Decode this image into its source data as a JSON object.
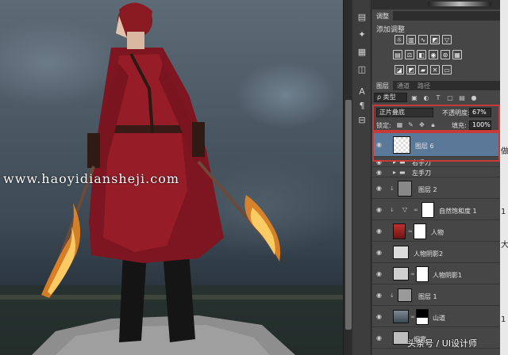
{
  "canvas": {
    "watermark": "www.haoyidiansheji.com"
  },
  "tool_column": {
    "icons": [
      "history-icon",
      "adjust-icon",
      "swatches-icon",
      "layer-comp-icon",
      "clone-icon",
      "character-icon",
      "paragraph-icon",
      "properties-icon"
    ]
  },
  "adjustments_panel": {
    "tabs": [
      "调整"
    ],
    "title": "添加调整",
    "row1": [
      "brightness-icon",
      "levels-icon",
      "curves-icon",
      "exposure-icon",
      "vibrance-icon"
    ],
    "row2": [
      "hue-saturation-icon",
      "color-balance-icon",
      "black-white-icon",
      "photo-filter-icon",
      "channel-mixer-icon",
      "color-lookup-icon"
    ],
    "row3": [
      "invert-icon",
      "posterize-icon",
      "threshold-icon",
      "selective-color-icon",
      "gradient-map-icon"
    ]
  },
  "layers_panel": {
    "tabs": [
      "图层",
      "通道",
      "路径"
    ],
    "filter": "ρ 类型",
    "blend_mode": "正片叠底",
    "opacity_label": "不透明度:",
    "opacity_value": "67%",
    "lock_label": "锁定:",
    "fill_label": "填充:",
    "fill_value": "100%",
    "layers": [
      {
        "name": "图层 6",
        "selected": true
      },
      {
        "name": "右手刀",
        "type": "group"
      },
      {
        "name": "左手刀",
        "type": "group"
      },
      {
        "name": "图层 2"
      },
      {
        "name": "自然饱和度 1",
        "type": "adjustment"
      },
      {
        "name": "人物"
      },
      {
        "name": "人物阴影2"
      },
      {
        "name": "人物阴影1"
      },
      {
        "name": "图层 1"
      },
      {
        "name": "山道"
      },
      {
        "name": "烟雾"
      }
    ]
  },
  "overlay_caption": "头条号 / UI设计师"
}
